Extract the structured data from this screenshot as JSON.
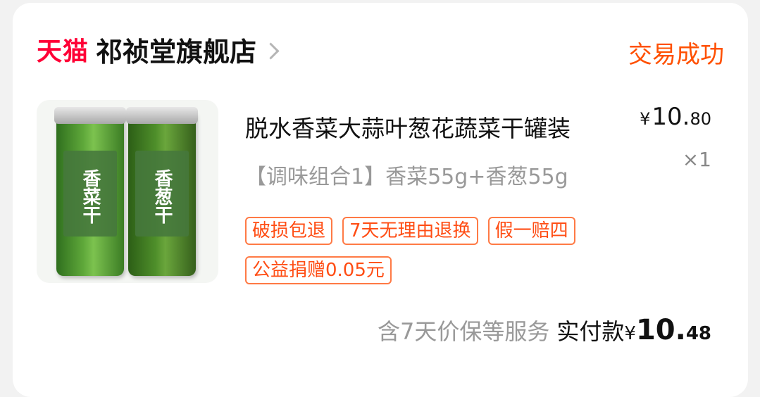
{
  "shop": {
    "platform_logo_text": "天猫",
    "name": "祁祯堂旗舰店",
    "status": "交易成功",
    "colors": {
      "platform": "#ff0036",
      "status": "#ff5000",
      "tag": "#ff4d14"
    }
  },
  "product": {
    "image_icon": "product-image",
    "jar_labels": [
      "香菜干",
      "香葱干"
    ],
    "title": "脱水香菜大蒜叶葱花蔬菜干罐装",
    "spec": "【调味组合1】香菜55g+香葱55g",
    "price_currency": "¥",
    "price_integer": "10.",
    "price_decimal": "80",
    "quantity": "×1",
    "tags": [
      "破损包退",
      "7天无理由退换",
      "假一赔四",
      "公益捐赠0.05元"
    ]
  },
  "total": {
    "service_note": "含7天价保等服务",
    "paid_label": "实付款",
    "currency": "¥",
    "integer": "10.",
    "decimal": "48"
  }
}
